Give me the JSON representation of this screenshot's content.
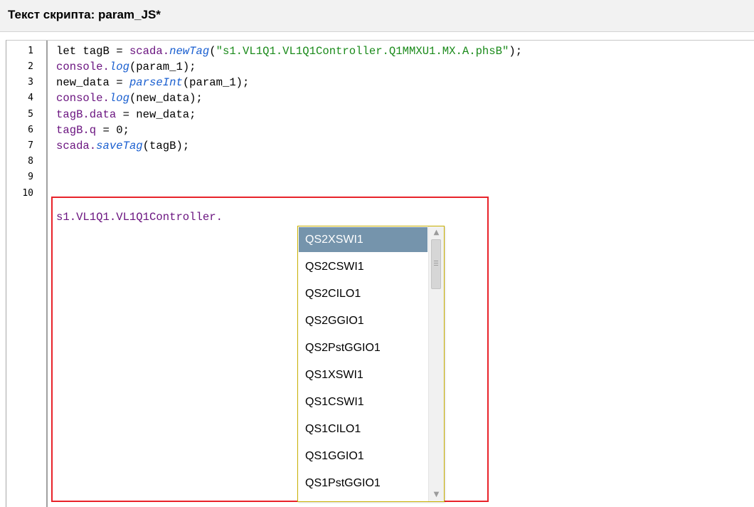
{
  "title": "Текст скрипта: param_JS*",
  "line_numbers": [
    "1",
    "2",
    "3",
    "4",
    "5",
    "6",
    "7",
    "8",
    "9",
    "10"
  ],
  "code": {
    "l1": {
      "a": "let tagB = ",
      "b": "scada.",
      "c": "newTag",
      "d": "(",
      "e": "\"s1.VL1Q1.VL1Q1Controller.Q1MMXU1.MX.A.phsB\"",
      "f": ");"
    },
    "l2": {
      "a": "console.",
      "b": "log",
      "c": "(param_1);"
    },
    "l3": {
      "a": "new_data = ",
      "b": "parseInt",
      "c": "(param_1);"
    },
    "l4": {
      "a": "console.",
      "b": "log",
      "c": "(new_data);"
    },
    "l5": {
      "a": "tagB.data",
      "b": " = new_data;"
    },
    "l6": {
      "a": "tagB.q",
      "b": " = 0;"
    },
    "l7": {
      "a": "scada.",
      "b": "saveTag",
      "c": "(tagB);"
    },
    "l9": {
      "a": "s1.VL1Q1.VL1Q1Controller."
    }
  },
  "autocomplete": {
    "selected_index": 0,
    "items": [
      "QS2XSWI1",
      "QS2CSWI1",
      "QS2CILO1",
      "QS2GGIO1",
      "QS2PstGGIO1",
      "QS1XSWI1",
      "QS1CSWI1",
      "QS1CILO1",
      "QS1GGIO1",
      "QS1PstGGIO1"
    ]
  },
  "icons": {
    "scroll_up": "chevron-up-icon",
    "scroll_down": "chevron-down-icon"
  },
  "colors": {
    "highlight_border": "#e8232a",
    "selected_item": "#7594ac",
    "object": "#6b1580",
    "function": "#1a5fd0",
    "string": "#1a8a1a"
  }
}
